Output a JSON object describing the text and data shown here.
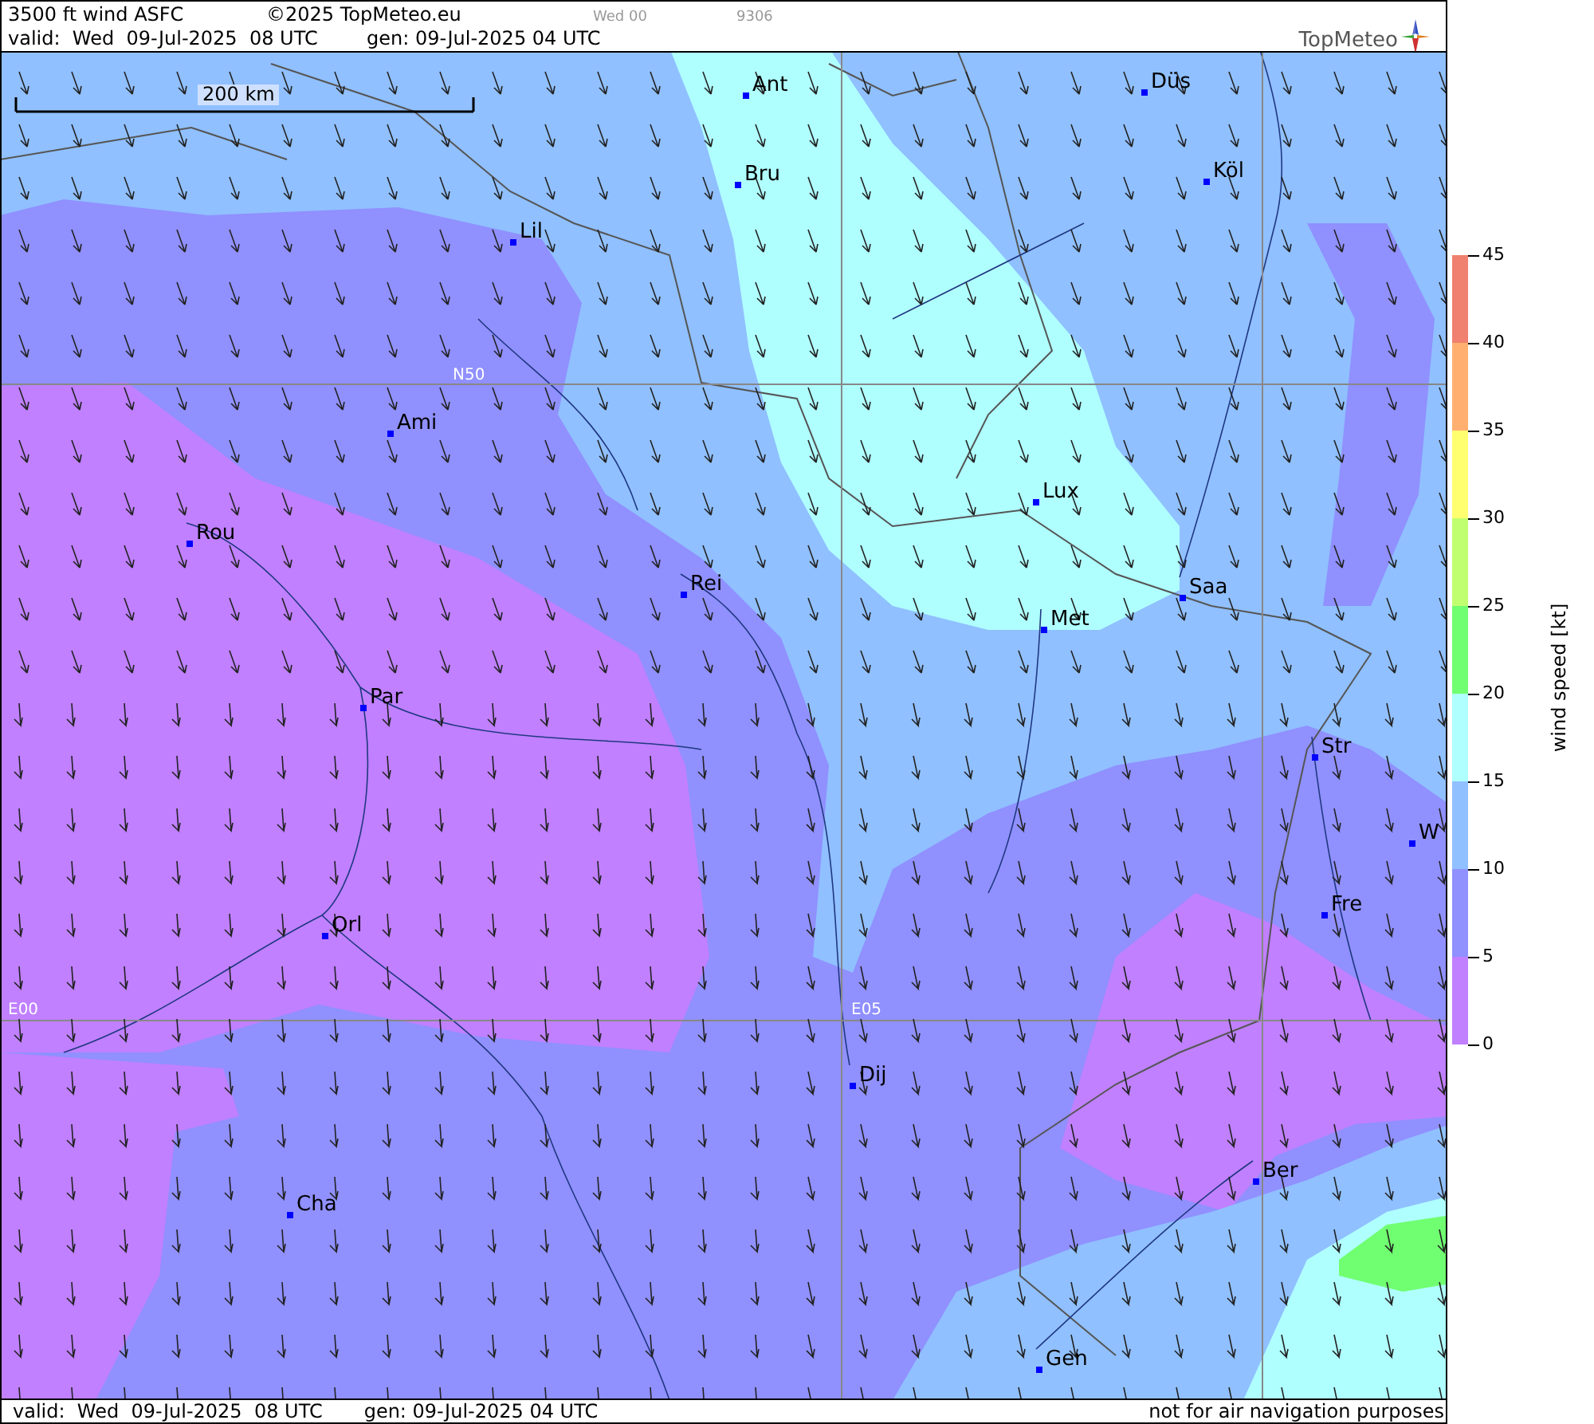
{
  "header": {
    "title": "3500 ft wind ASFC",
    "copyright": "©2025 TopMeteo.eu",
    "run_label": "Wed 00",
    "code": "9306",
    "valid": "valid:  Wed  09-Jul-2025  08 UTC",
    "generated": "gen: 09-Jul-2025 04 UTC",
    "logo": "TopMeteo"
  },
  "map": {
    "scale": "200 km",
    "grid_labels": [
      "N50",
      "E00",
      "E05"
    ],
    "cities": [
      "Ant",
      "Düs",
      "Bru",
      "Köl",
      "Lil",
      "Ami",
      "Rou",
      "Lux",
      "Rei",
      "Saa",
      "Met",
      "Par",
      "Str",
      "W",
      "Fre",
      "Orl",
      "Dij",
      "Ber",
      "Cha",
      "Gen"
    ]
  },
  "legend": {
    "title": "wind speed [kt]",
    "ticks": [
      "45",
      "40",
      "35",
      "30",
      "25",
      "20",
      "15",
      "10",
      "5",
      "0"
    ],
    "bands": [
      {
        "color": "#f08070"
      },
      {
        "color": "#ffb070"
      },
      {
        "color": "#ffff70"
      },
      {
        "color": "#c0ff70"
      },
      {
        "color": "#70ff70"
      },
      {
        "color": "#b0ffff"
      },
      {
        "color": "#90c0ff"
      },
      {
        "color": "#9090ff"
      },
      {
        "color": "#c080ff"
      }
    ]
  },
  "footer": {
    "valid": "valid:  Wed  09-Jul-2025  08 UTC",
    "generated": "gen: 09-Jul-2025 04 UTC",
    "disclaimer": "not for air navigation purposes"
  }
}
